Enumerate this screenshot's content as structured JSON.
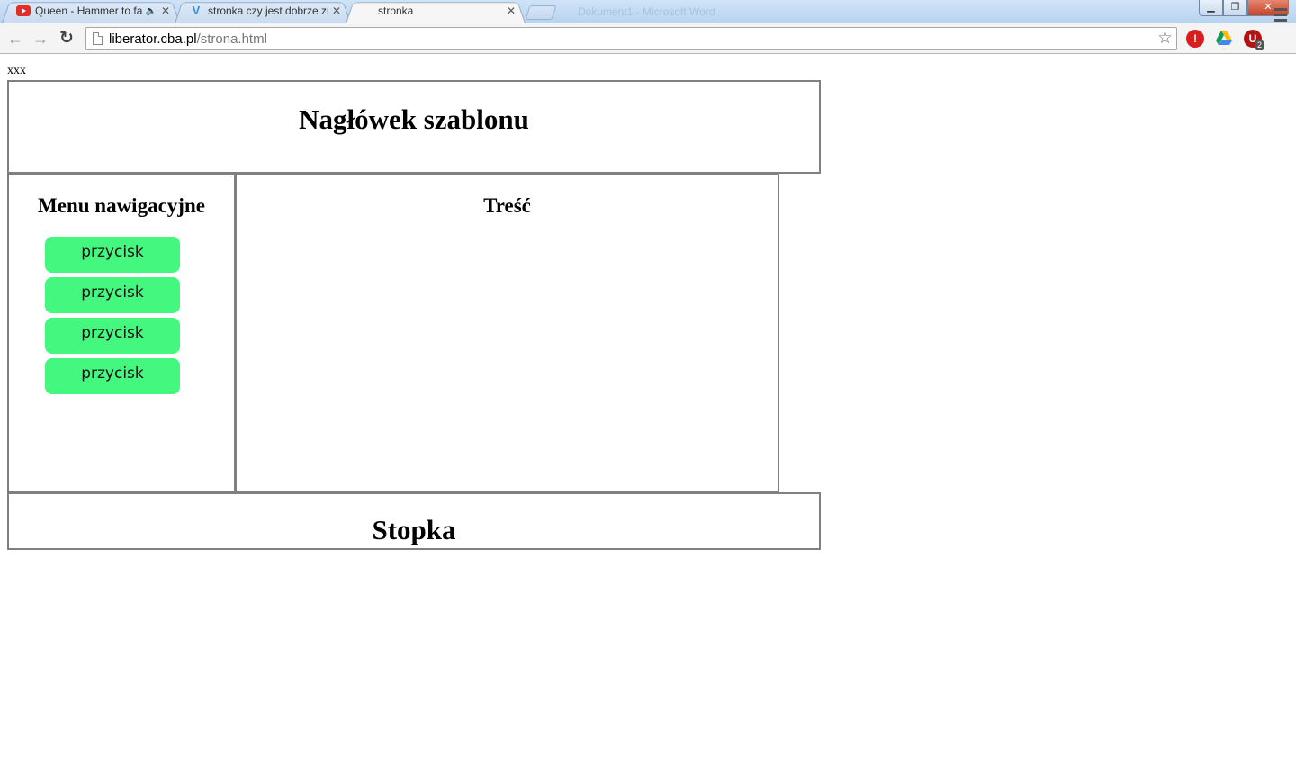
{
  "browser": {
    "tabs": [
      {
        "title": "Queen - Hammer to fa",
        "audio": true
      },
      {
        "title": "stronka czy jest dobrze zro"
      },
      {
        "title": "stronka"
      }
    ],
    "ghost_title": "Dokument1 - Microsoft Word",
    "url_host": "liberator.cba.pl",
    "url_path": "/strona.html",
    "extension_badge": "2"
  },
  "page": {
    "top_text": "xxx",
    "header_title": "Nagłówek szablonu",
    "menu_title": "Menu nawigacyjne",
    "menu_buttons": [
      "przycisk",
      "przycisk",
      "przycisk",
      "przycisk"
    ],
    "content_title": "Treść",
    "footer_title": "Stopka",
    "accent_color": "#43f77f"
  }
}
